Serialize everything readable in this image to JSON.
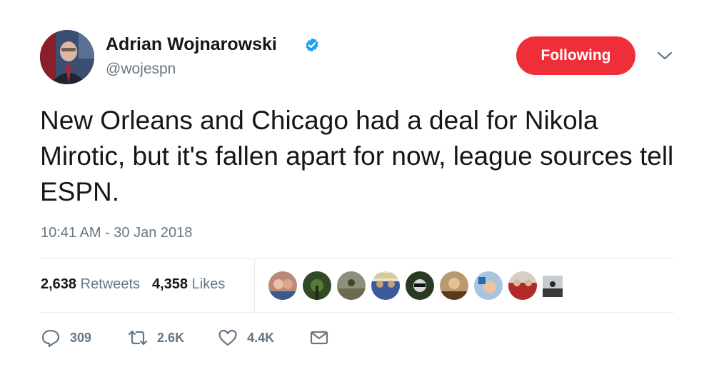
{
  "author": {
    "name": "Adrian Wojnarowski",
    "handle": "@wojespn",
    "avatar_icon": "profile-photo",
    "verified_icon": "verified-badge-icon"
  },
  "follow_button": {
    "label": "Following"
  },
  "menu": {
    "icon": "chevron-down-icon"
  },
  "tweet": {
    "text": "New Orleans and Chicago had a deal for Nikola Mirotic, but it's fallen apart for now, league sources tell ESPN.",
    "timestamp": "10:41 AM - 30 Jan 2018"
  },
  "stats": {
    "retweets_count": "2,638",
    "retweets_label": "Retweets",
    "likes_count": "4,358",
    "likes_label": "Likes"
  },
  "likers_count_shown": 9,
  "actions": {
    "reply_count": "309",
    "retweet_count": "2.6K",
    "like_count": "4.4K"
  },
  "colors": {
    "accent": "#f02e39",
    "secondary_text": "#657786",
    "verified": "#1da1f2",
    "primary_text": "#14171a"
  }
}
